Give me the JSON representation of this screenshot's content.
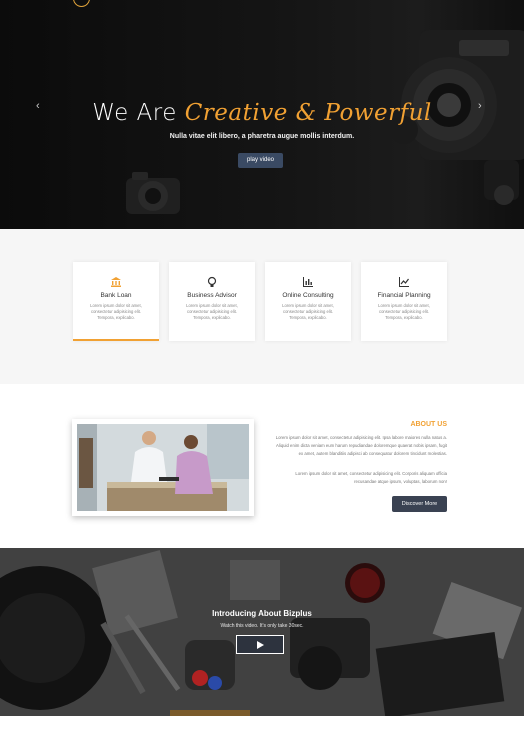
{
  "hero": {
    "title_plain": "We Are ",
    "title_accent": "Creative & Powerful",
    "subtitle": "Nulla vitae elit libero, a pharetra augue mollis interdum.",
    "button_label": "play video",
    "prev_arrow": "‹",
    "next_arrow": "›",
    "accent_color": "#f1a133"
  },
  "services": {
    "cards": [
      {
        "icon": "bank-icon",
        "title": "Bank Loan",
        "desc": "Lorem ipsum dolor sit amet, consectetur adipisicing elit. Tempora, explicabo.",
        "active": true
      },
      {
        "icon": "lightbulb-icon",
        "title": "Business Advisor",
        "desc": "Lorem ipsum dolor sit amet, consectetur adipisicing elit. Tempora, explicabo.",
        "active": false
      },
      {
        "icon": "bar-chart-icon",
        "title": "Online Consulting",
        "desc": "Lorem ipsum dolor sit amet, consectetur adipisicing elit. Tempora, explicabo.",
        "active": false
      },
      {
        "icon": "line-chart-icon",
        "title": "Financial Planning",
        "desc": "Lorem ipsum dolor sit amet, consectetur adipisicing elit. Tempora, explicabo.",
        "active": false
      }
    ]
  },
  "about": {
    "title": "ABOUT US",
    "paragraph1": "Lorem ipsum dolor sit amet, consectetur adipisicing elit. Ipsa labore maiores nulla natus a. Aliquid enim dicta veniam eum harum repudiandae doloremque quaerat nobis ipsam, fugit ex amet, autem blanditiis adipisci ab consequatur dolorem tincidunt molestias.",
    "paragraph2": "Lorem ipsum dolor sit amet, consectetur adipisicing elit. Corporis aliquam officia recusandae atque ipsum, voluptas, laborum non!",
    "button_label": "Discover More"
  },
  "video": {
    "title": "Introducing About Bizplus",
    "subtitle": "Watch this video. It's only take 30sec."
  },
  "colors": {
    "accent": "#f1a133",
    "button_dark": "#3a4252",
    "hero_bg": "#111111",
    "services_bg": "#f6f6f6"
  }
}
